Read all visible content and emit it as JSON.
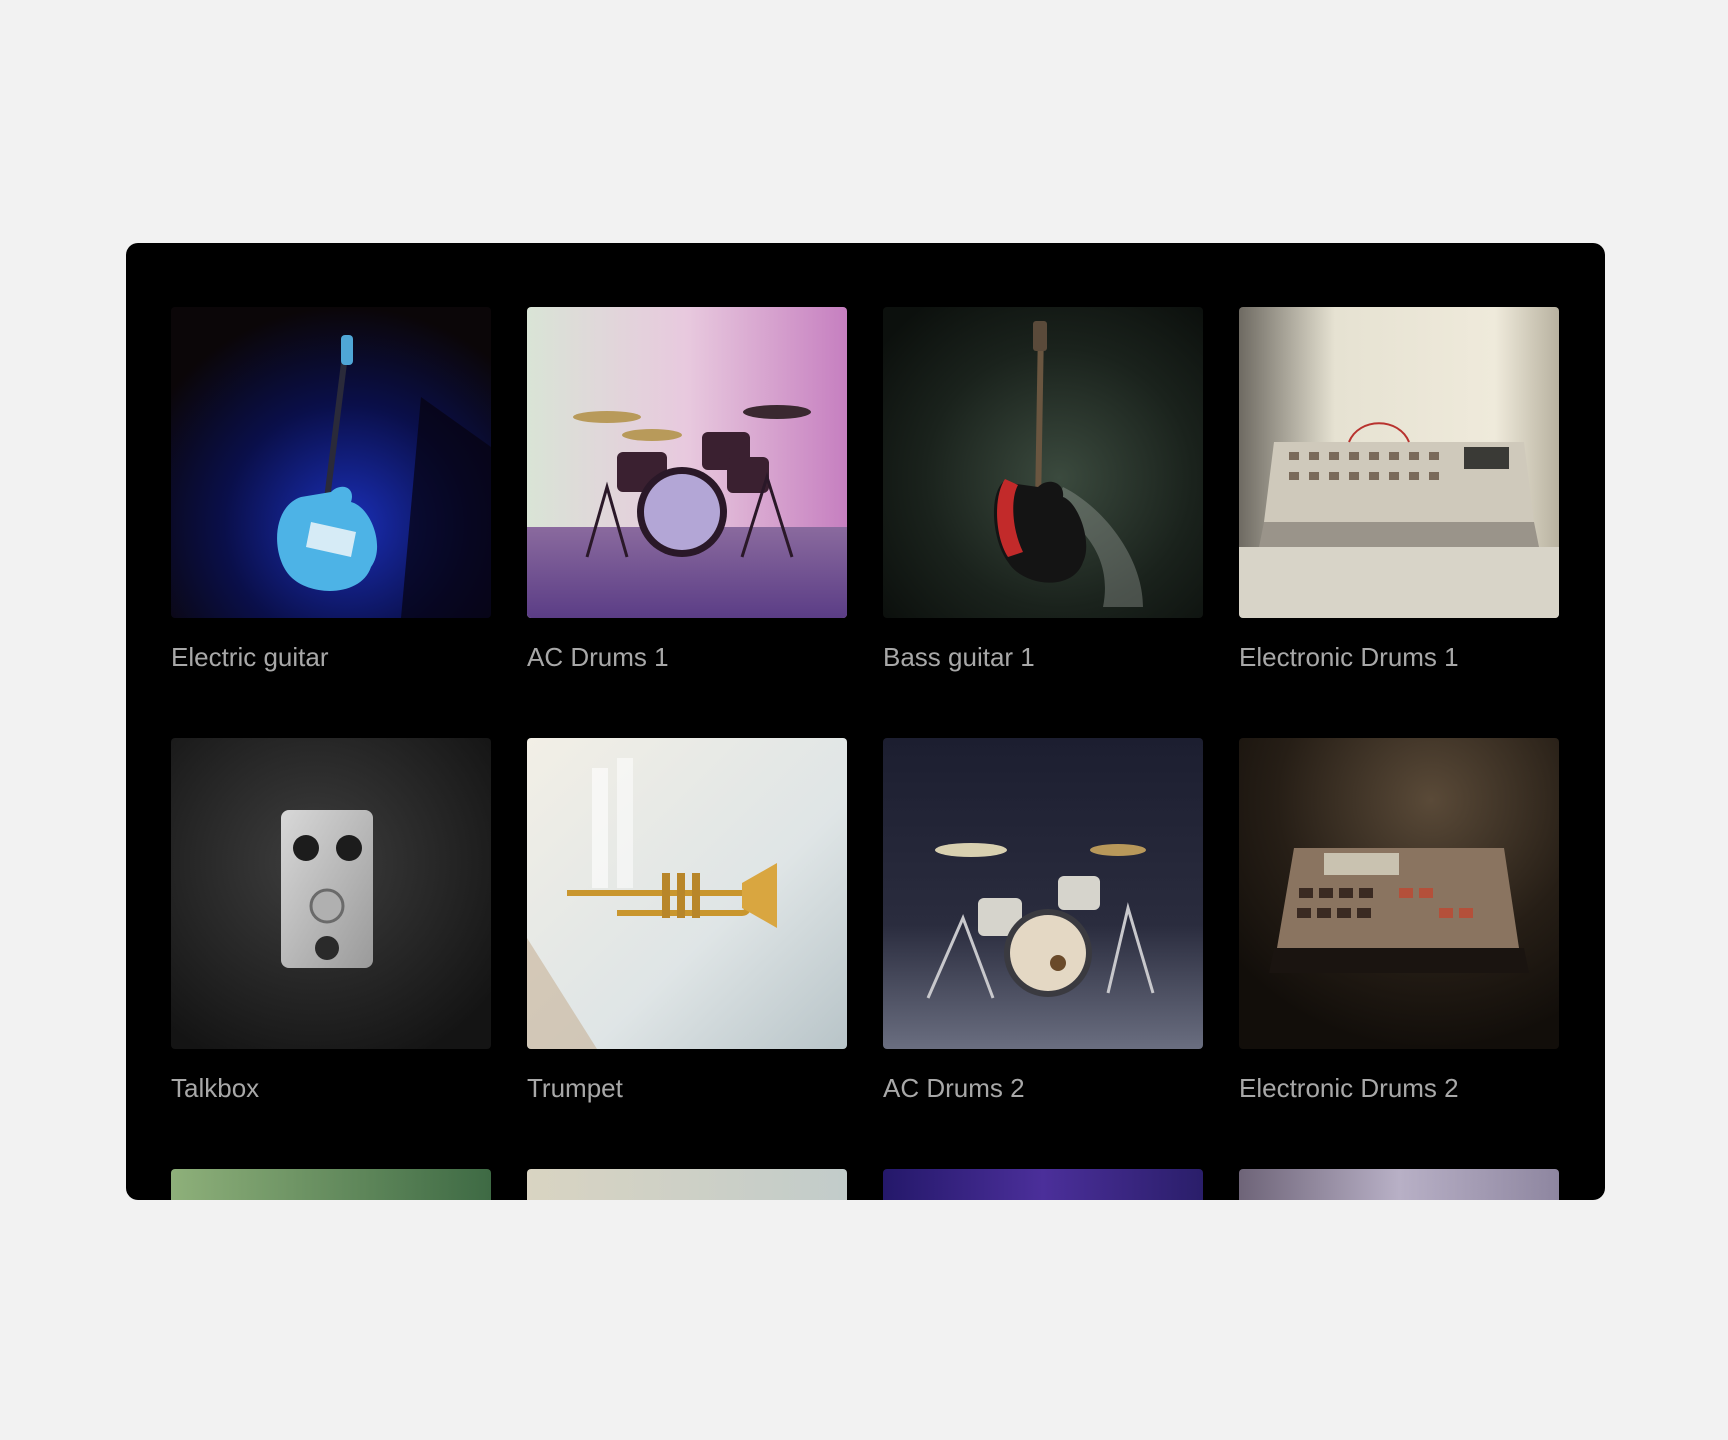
{
  "gallery": {
    "items": [
      {
        "label": "Electric guitar",
        "icon": "electric-guitar-image"
      },
      {
        "label": "AC Drums 1",
        "icon": "drum-kit-image"
      },
      {
        "label": "Bass guitar 1",
        "icon": "bass-guitar-image"
      },
      {
        "label": "Electronic Drums 1",
        "icon": "drum-machine-image"
      },
      {
        "label": "Talkbox",
        "icon": "effects-pedal-image"
      },
      {
        "label": "Trumpet",
        "icon": "trumpet-image"
      },
      {
        "label": "AC Drums 2",
        "icon": "drum-kit-image"
      },
      {
        "label": "Electronic Drums 2",
        "icon": "sampler-image"
      }
    ]
  },
  "colors": {
    "page_background": "#f2f2f2",
    "panel_background": "#000000",
    "label_text": "#a8a8a8"
  }
}
